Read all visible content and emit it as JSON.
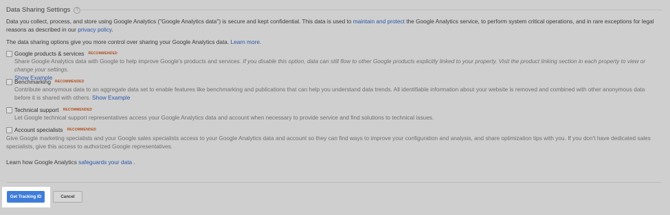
{
  "section": {
    "title": "Data Sharing Settings",
    "help_glyph": "?"
  },
  "intro": {
    "text1": "Data you collect, process, and store using Google Analytics (\"Google Analytics data\") is secure and kept confidential. This data is used to ",
    "link1": "maintain and protect",
    "text2": " the Google Analytics service, to perform system critical operations, and in rare exceptions for legal reasons as described in our ",
    "link2": "privacy policy",
    "text3": "."
  },
  "options_intro": {
    "text": "The data sharing options give you more control over sharing your Google Analytics data. ",
    "link": "Learn more."
  },
  "options": [
    {
      "label": "Google products & services",
      "badge": "RECOMMENDED",
      "desc": "Share Google Analytics data with Google to help improve Google's products and services. ",
      "italic1": "If you disable this option, data can still flow to other Google products explicitly linked to your property. Visit the ",
      "italic_link": "product linking",
      "italic2": " section in each property to view or change your settings.",
      "link": "Show Example"
    },
    {
      "label": "Benchmarking",
      "badge": "RECOMMENDED",
      "desc": "Contribute anonymous data to an aggregate data set to enable features like benchmarking and publications that can help you understand data trends. All identifiable information about your website is removed and combined with other anonymous data before it is shared with others. ",
      "link": "Show Example"
    },
    {
      "label": "Technical support",
      "badge": "RECOMMENDED",
      "desc": "Let Google technical support representatives access your Google Analytics data and account when necessary to provide service and find solutions to technical issues."
    },
    {
      "label": "Account specialists",
      "badge": "RECOMMENDED",
      "desc": "Give Google marketing specialists and your Google sales specialists access to your Google Analytics data and account so they can find ways to improve your configuration and analysis, and share optimization tips with you. If you don't have dedicated sales specialists, give this access to authorized Google representatives."
    }
  ],
  "safeguards": {
    "text": "Learn how Google Analytics ",
    "link": "safeguards your data",
    "suffix": " ."
  },
  "buttons": {
    "primary": "Get Tracking ID",
    "cancel": "Cancel"
  },
  "colors": {
    "background": "#cfcfcf",
    "link": "#2a57a8",
    "badge": "#b34d1b",
    "primary_button": "#3f7dd9"
  }
}
